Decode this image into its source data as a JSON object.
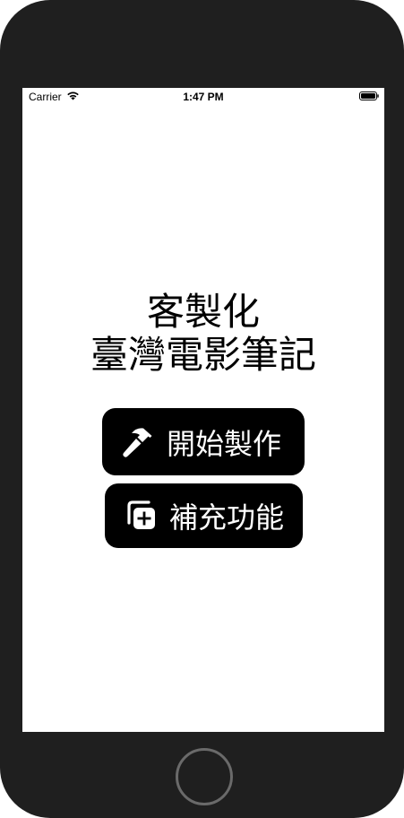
{
  "status_bar": {
    "carrier": "Carrier",
    "time": "1:47 PM",
    "wifi_icon": "wifi-icon",
    "battery_icon": "battery-icon"
  },
  "title": {
    "line1": "客製化",
    "line2": "臺灣電影筆記"
  },
  "buttons": {
    "start": {
      "label": "開始製作",
      "icon": "hammer-icon"
    },
    "extra": {
      "label": "補充功能",
      "icon": "plus-square-stack-icon"
    }
  },
  "colors": {
    "button_bg": "#000000",
    "button_text": "#ffffff",
    "bezel": "#1f1f1f"
  }
}
